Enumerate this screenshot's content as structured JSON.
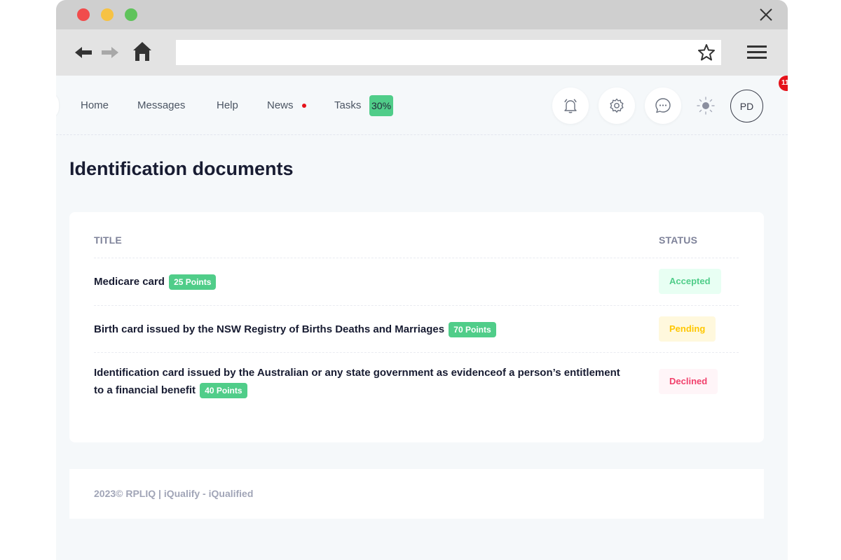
{
  "browser": {
    "url": "",
    "icons": [
      "back-arrow-icon",
      "forward-arrow-icon",
      "home-icon",
      "star-icon",
      "hamburger-menu-icon",
      "close-icon"
    ]
  },
  "nav": {
    "home": "Home",
    "messages": "Messages",
    "help": "Help",
    "news": "News",
    "tasks": "Tasks",
    "tasks_progress": "30%",
    "avatar_initials": "PD",
    "notification_badge": "11"
  },
  "page": {
    "title": "Identification documents"
  },
  "table": {
    "headers": {
      "title": "TITLE",
      "status": "STATUS"
    },
    "rows": [
      {
        "title": "Medicare card",
        "points": "25 Points",
        "status": "Accepted"
      },
      {
        "title": "Birth card issued by the NSW Registry of Births Deaths and Marriages",
        "points": "70 Points",
        "status": "Pending"
      },
      {
        "title": "Identification card issued by the Australian or any state government as evidenceof a person’s entitlement to a financial benefit",
        "points": "40 Points",
        "status": "Declined"
      }
    ]
  },
  "footer": {
    "text": "2023© RPLIQ | iQualify - iQualified"
  },
  "colors": {
    "accent_green": "#50cd89",
    "pending_yellow": "#ffc700",
    "declined_red": "#f1416c",
    "news_dot": "#e5121a"
  }
}
